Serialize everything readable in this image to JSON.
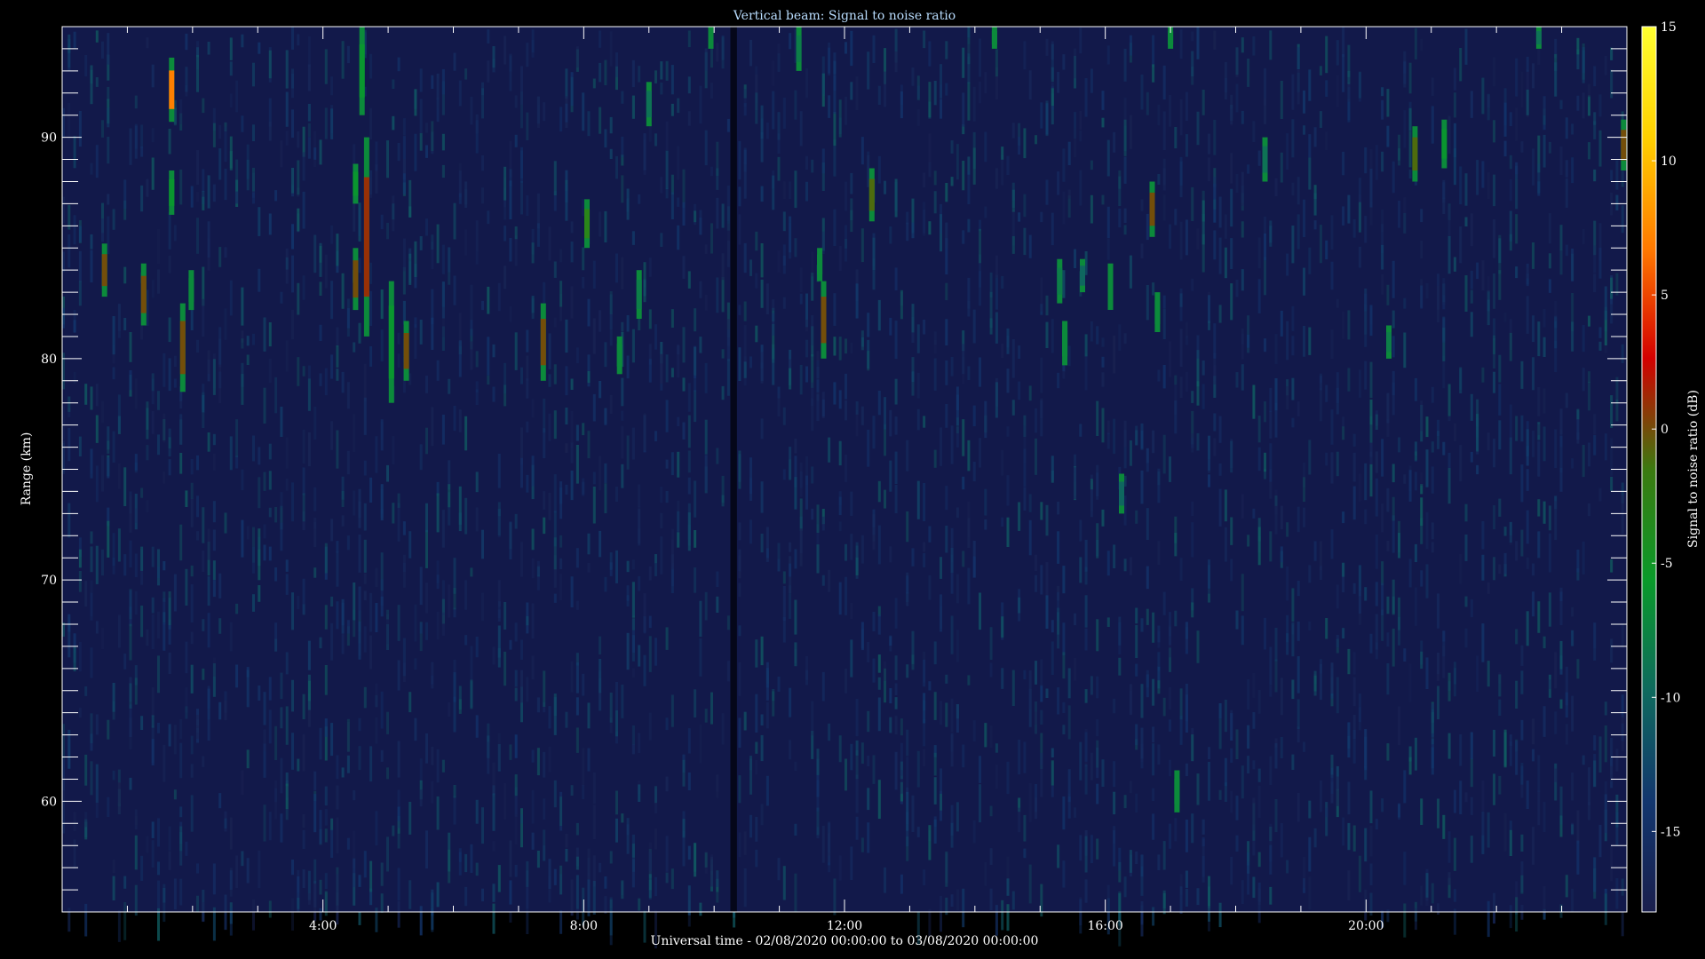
{
  "chart_data": {
    "type": "heatmap",
    "title": "Vertical beam: Signal to noise ratio",
    "xlabel": "Universal time - 02/08/2020 00:00:00 to 03/08/2020 00:00:00",
    "ylabel": "Range (km)",
    "colorbar_label": "Signal to noise ratio (dB)",
    "xlim": [
      0,
      24
    ],
    "ylim": [
      55,
      95
    ],
    "clim": [
      -18,
      15
    ],
    "x_ticks": [
      {
        "value": 4,
        "label": "4:00"
      },
      {
        "value": 8,
        "label": "8:00"
      },
      {
        "value": 12,
        "label": "12:00"
      },
      {
        "value": 16,
        "label": "16:00"
      },
      {
        "value": 20,
        "label": "20:00"
      }
    ],
    "y_ticks": [
      {
        "value": 60,
        "label": "60"
      },
      {
        "value": 70,
        "label": "70"
      },
      {
        "value": 80,
        "label": "80"
      },
      {
        "value": 90,
        "label": "90"
      }
    ],
    "colorbar_ticks": [
      {
        "value": 15,
        "label": "15"
      },
      {
        "value": 10,
        "label": "10"
      },
      {
        "value": 5,
        "label": "5"
      },
      {
        "value": 0,
        "label": "0"
      },
      {
        "value": -5,
        "label": "-5"
      },
      {
        "value": -10,
        "label": "-10"
      },
      {
        "value": -15,
        "label": "-15"
      }
    ],
    "colormap": [
      "#1a1f4d",
      "#12366e",
      "#0f6a5e",
      "#0a9a2a",
      "#3c7a10",
      "#d40000",
      "#ff7a00",
      "#ffd000",
      "#ffff30"
    ],
    "background_color": "#12194a",
    "data_gap": [
      10.25,
      10.35
    ],
    "events": [
      {
        "t": 0.65,
        "r0": 82.8,
        "r1": 85.2,
        "snr": 0
      },
      {
        "t": 1.25,
        "r0": 81.5,
        "r1": 84.3,
        "snr": 0
      },
      {
        "t": 1.68,
        "r0": 90.7,
        "r1": 93.6,
        "snr": 7
      },
      {
        "t": 1.68,
        "r0": 86.5,
        "r1": 88.5,
        "snr": -6
      },
      {
        "t": 1.85,
        "r0": 78.5,
        "r1": 82.5,
        "snr": 0
      },
      {
        "t": 1.98,
        "r0": 82.2,
        "r1": 84.0,
        "snr": -7
      },
      {
        "t": 4.5,
        "r0": 82.2,
        "r1": 85.0,
        "snr": 0
      },
      {
        "t": 4.5,
        "r0": 87.0,
        "r1": 88.8,
        "snr": -6
      },
      {
        "t": 4.6,
        "r0": 91.0,
        "r1": 95.0,
        "snr": -6
      },
      {
        "t": 4.67,
        "r0": 81.0,
        "r1": 90.0,
        "snr": 1
      },
      {
        "t": 5.05,
        "r0": 78.0,
        "r1": 83.5,
        "snr": -6
      },
      {
        "t": 5.28,
        "r0": 79.0,
        "r1": 81.7,
        "snr": 0
      },
      {
        "t": 7.38,
        "r0": 79.0,
        "r1": 82.5,
        "snr": 0
      },
      {
        "t": 8.05,
        "r0": 85.0,
        "r1": 87.2,
        "snr": -3
      },
      {
        "t": 8.55,
        "r0": 79.3,
        "r1": 81.0,
        "snr": -7
      },
      {
        "t": 8.85,
        "r0": 81.8,
        "r1": 84.0,
        "snr": -8
      },
      {
        "t": 9.0,
        "r0": 90.5,
        "r1": 92.5,
        "snr": -9
      },
      {
        "t": 9.95,
        "r0": 94.0,
        "r1": 95.0,
        "snr": -7
      },
      {
        "t": 11.3,
        "r0": 93.0,
        "r1": 95.0,
        "snr": -8
      },
      {
        "t": 11.62,
        "r0": 83.5,
        "r1": 85.0,
        "snr": -7
      },
      {
        "t": 11.68,
        "r0": 80.0,
        "r1": 83.5,
        "snr": 0
      },
      {
        "t": 12.42,
        "r0": 86.2,
        "r1": 88.6,
        "snr": -1
      },
      {
        "t": 14.3,
        "r0": 94.0,
        "r1": 95.0,
        "snr": -7
      },
      {
        "t": 15.3,
        "r0": 82.5,
        "r1": 84.5,
        "snr": -8
      },
      {
        "t": 15.38,
        "r0": 79.7,
        "r1": 81.7,
        "snr": -7
      },
      {
        "t": 15.65,
        "r0": 83.0,
        "r1": 84.5,
        "snr": -10
      },
      {
        "t": 16.08,
        "r0": 82.2,
        "r1": 84.3,
        "snr": -7
      },
      {
        "t": 16.25,
        "r0": 73.0,
        "r1": 74.8,
        "snr": -10
      },
      {
        "t": 16.72,
        "r0": 85.5,
        "r1": 88.0,
        "snr": 0
      },
      {
        "t": 16.8,
        "r0": 81.2,
        "r1": 83.0,
        "snr": -7
      },
      {
        "t": 17.0,
        "r0": 94.0,
        "r1": 95.0,
        "snr": -7
      },
      {
        "t": 17.1,
        "r0": 59.5,
        "r1": 61.4,
        "snr": -7
      },
      {
        "t": 18.45,
        "r0": 88.0,
        "r1": 90.0,
        "snr": -9
      },
      {
        "t": 20.35,
        "r0": 80.0,
        "r1": 81.5,
        "snr": -8
      },
      {
        "t": 20.75,
        "r0": 88.0,
        "r1": 90.5,
        "snr": -1
      },
      {
        "t": 21.2,
        "r0": 88.6,
        "r1": 90.8,
        "snr": -6
      },
      {
        "t": 22.65,
        "r0": 94.0,
        "r1": 95.0,
        "snr": -9
      },
      {
        "t": 23.95,
        "r0": 88.5,
        "r1": 90.8,
        "snr": 0
      }
    ]
  }
}
